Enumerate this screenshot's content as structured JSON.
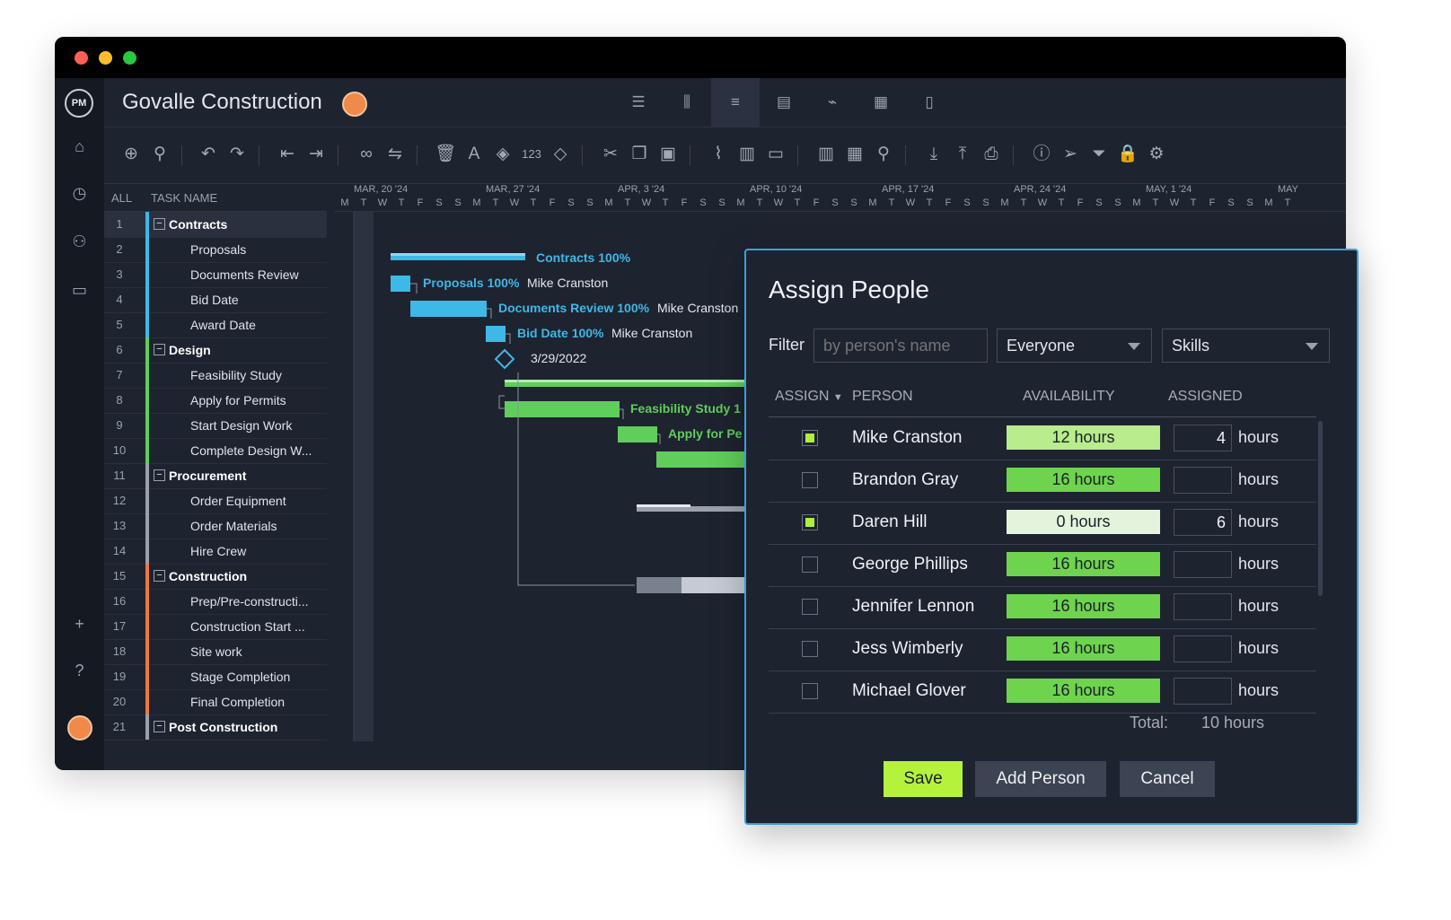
{
  "app": {
    "project_title": "Govalle Construction",
    "logo_text": "PM",
    "view_tabs": [
      "list-icon",
      "board-icon",
      "gantt-icon",
      "sheet-icon",
      "dashboard-icon",
      "calendar-icon",
      "document-icon"
    ],
    "active_view": "gantt-icon"
  },
  "toolbar": {
    "icons": [
      "add-task-icon",
      "add-user-icon",
      "undo-icon",
      "redo-icon",
      "outdent-icon",
      "indent-icon",
      "link-icon",
      "unlink-icon",
      "delete-icon",
      "font-color-icon",
      "fill-color-icon",
      "numbering-icon",
      "milestone-icon",
      "cut-icon",
      "copy-icon",
      "paste-icon",
      "attach-icon",
      "notes-icon",
      "comment-icon",
      "columns-icon",
      "grid-icon",
      "zoom-icon",
      "import-icon",
      "export-icon",
      "print-icon",
      "info-icon",
      "share-icon",
      "filter-icon",
      "lock-icon",
      "settings-icon"
    ],
    "numbering_label": "123"
  },
  "rail": {
    "icons": [
      "home-icon",
      "clock-icon",
      "team-icon",
      "briefcase-icon",
      "plus-icon",
      "help-icon",
      "user-avatar"
    ]
  },
  "task_list": {
    "col_all": "ALL",
    "col_name": "TASK NAME",
    "rows": [
      {
        "num": "1",
        "name": "Contracts",
        "group": true,
        "color": "#3eb8e6"
      },
      {
        "num": "2",
        "name": "Proposals",
        "group": false,
        "color": "#3eb8e6"
      },
      {
        "num": "3",
        "name": "Documents Review",
        "group": false,
        "color": "#3eb8e6"
      },
      {
        "num": "4",
        "name": "Bid Date",
        "group": false,
        "color": "#3eb8e6"
      },
      {
        "num": "5",
        "name": "Award Date",
        "group": false,
        "color": "#3eb8e6"
      },
      {
        "num": "6",
        "name": "Design",
        "group": true,
        "color": "#5fce5a"
      },
      {
        "num": "7",
        "name": "Feasibility Study",
        "group": false,
        "color": "#5fce5a"
      },
      {
        "num": "8",
        "name": "Apply for Permits",
        "group": false,
        "color": "#5fce5a"
      },
      {
        "num": "9",
        "name": "Start Design Work",
        "group": false,
        "color": "#5fce5a"
      },
      {
        "num": "10",
        "name": "Complete Design W...",
        "group": false,
        "color": "#5fce5a"
      },
      {
        "num": "11",
        "name": "Procurement",
        "group": true,
        "color": "#9aa1ad"
      },
      {
        "num": "12",
        "name": "Order Equipment",
        "group": false,
        "color": "#9aa1ad"
      },
      {
        "num": "13",
        "name": "Order Materials",
        "group": false,
        "color": "#9aa1ad"
      },
      {
        "num": "14",
        "name": "Hire Crew",
        "group": false,
        "color": "#9aa1ad"
      },
      {
        "num": "15",
        "name": "Construction",
        "group": true,
        "color": "#ef7a3a"
      },
      {
        "num": "16",
        "name": "Prep/Pre-constructi...",
        "group": false,
        "color": "#ef7a3a"
      },
      {
        "num": "17",
        "name": "Construction Start ...",
        "group": false,
        "color": "#ef7a3a"
      },
      {
        "num": "18",
        "name": "Site work",
        "group": false,
        "color": "#ef7a3a"
      },
      {
        "num": "19",
        "name": "Stage Completion",
        "group": false,
        "color": "#ef7a3a"
      },
      {
        "num": "20",
        "name": "Final Completion",
        "group": false,
        "color": "#ef7a3a"
      },
      {
        "num": "21",
        "name": "Post Construction",
        "group": true,
        "color": "#9aa1ad"
      }
    ]
  },
  "gantt": {
    "weeks": [
      "MAR, 20 '24",
      "MAR, 27 '24",
      "APR, 3 '24",
      "APR, 10 '24",
      "APR, 17 '24",
      "APR, 24 '24",
      "MAY, 1 '24",
      "MAY"
    ],
    "day_letters": [
      "M",
      "T",
      "W",
      "T",
      "F",
      "S",
      "S",
      "M",
      "T",
      "W",
      "T",
      "F",
      "S",
      "S",
      "M",
      "T",
      "W",
      "T",
      "F",
      "S",
      "S",
      "M",
      "T",
      "W",
      "T",
      "F",
      "S",
      "S",
      "M",
      "T",
      "W",
      "T",
      "F",
      "S",
      "S",
      "M",
      "T",
      "W",
      "T",
      "F",
      "S",
      "S",
      "M",
      "T",
      "W",
      "T",
      "F",
      "S",
      "S",
      "M",
      "T"
    ],
    "labels": {
      "contracts": "Contracts",
      "contracts_pct": "100%",
      "proposals": "Proposals",
      "proposals_pct": "100%",
      "proposals_person": "Mike Cranston",
      "docs": "Documents Review",
      "docs_pct": "100%",
      "docs_person": "Mike Cranston",
      "bid": "Bid Date",
      "bid_pct": "100%",
      "bid_person": "Mike Cranston",
      "award_date": "3/29/2022",
      "feasibility": "Feasibility Study",
      "feasibility_pct": "1",
      "permits": "Apply for Pe"
    }
  },
  "dialog": {
    "title": "Assign People",
    "filter_label": "Filter",
    "filter_placeholder": "by person's name",
    "group_select": "Everyone",
    "skills_select": "Skills",
    "col_assign": "ASSIGN",
    "col_person": "PERSON",
    "col_availability": "AVAILABILITY",
    "col_assigned": "ASSIGNED",
    "people": [
      {
        "name": "Mike Cranston",
        "checked": true,
        "availability": "12 hours",
        "avail_color": "#b8ec8c",
        "assigned": "4",
        "unit": "hours"
      },
      {
        "name": "Brandon Gray",
        "checked": false,
        "availability": "16 hours",
        "avail_color": "#6ed44e",
        "assigned": "",
        "unit": "hours"
      },
      {
        "name": "Daren Hill",
        "checked": true,
        "availability": "0 hours",
        "avail_color": "#e4f4dc",
        "assigned": "6",
        "unit": "hours"
      },
      {
        "name": "George Phillips",
        "checked": false,
        "availability": "16 hours",
        "avail_color": "#6ed44e",
        "assigned": "",
        "unit": "hours"
      },
      {
        "name": "Jennifer Lennon",
        "checked": false,
        "availability": "16 hours",
        "avail_color": "#6ed44e",
        "assigned": "",
        "unit": "hours"
      },
      {
        "name": "Jess Wimberly",
        "checked": false,
        "availability": "16 hours",
        "avail_color": "#6ed44e",
        "assigned": "",
        "unit": "hours"
      },
      {
        "name": "Michael Glover",
        "checked": false,
        "availability": "16 hours",
        "avail_color": "#6ed44e",
        "assigned": "",
        "unit": "hours"
      }
    ],
    "total_label": "Total:",
    "total_value": "10 hours",
    "save_label": "Save",
    "add_person_label": "Add Person",
    "cancel_label": "Cancel"
  }
}
